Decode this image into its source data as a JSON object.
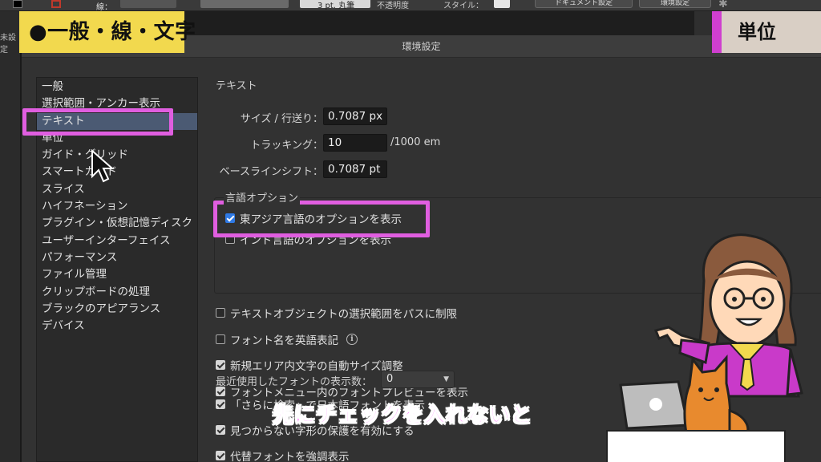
{
  "toolbar": {
    "stroke_label": "線：",
    "stroke_weight_value": "3 pt. 丸筆",
    "opacity_label": "不透明度",
    "style_label": "スタイル：",
    "document_settings_button": "ドキュメント設定",
    "preferences_button": "環境設定"
  },
  "background_panel": {
    "label": "未設定"
  },
  "dialog": {
    "title": "環境設定",
    "sidebar_items": [
      "一般",
      "選択範囲・アンカー表示",
      "テキスト",
      "単位",
      "ガイド・グリッド",
      "スマートガイド",
      "スライス",
      "ハイフネーション",
      "プラグイン・仮想記憶ディスク",
      "ユーザーインターフェイス",
      "パフォーマンス",
      "ファイル管理",
      "クリップボードの処理",
      "ブラックのアピアランス",
      "デバイス"
    ],
    "selected_sidebar_item": "テキスト",
    "text_section": {
      "title": "テキスト",
      "size_leading_label": "サイズ / 行送り：",
      "size_leading_value": "0.7087 px",
      "tracking_label": "トラッキング：",
      "tracking_value": "10",
      "tracking_unit": "/1000 em",
      "baseline_shift_label": "ベースラインシフト：",
      "baseline_shift_value": "0.7087 pt"
    },
    "language_options": {
      "title": "言語オプション",
      "east_asian_label": "東アジア言語のオプションを表示",
      "east_asian_checked": true,
      "indic_label": "インド言語のオプションを表示",
      "indic_checked": false
    },
    "options": [
      {
        "label": "テキストオブジェクトの選択範囲をパスに制限",
        "checked": false
      },
      {
        "label": "フォント名を英語表記",
        "checked": false,
        "info": "i"
      },
      {
        "label": "新規エリア内文字の自動サイズ調整",
        "checked": true
      },
      {
        "label": "フォントメニュー内のフォントプレビューを表示",
        "checked": true
      }
    ],
    "recent_fonts_label": "最近使用したフォントの表示数：",
    "recent_fonts_value": "0",
    "bottom_options": [
      {
        "label": "「さらに検索」で日本語フォントを表示",
        "checked": true
      },
      {
        "label": "見つからない字形の保護を有効にする",
        "checked": true
      },
      {
        "label": "代替フォントを強調表示",
        "checked": true
      }
    ]
  },
  "overlays": {
    "left_tag": "●一般・線・文字",
    "right_tag": "単位",
    "caption": "先にチェックを入れないと"
  },
  "colors": {
    "highlight": "#e05ee0",
    "left_tag_bg": "#f2d94e",
    "selected_item_bg": "#4b5a73",
    "checkbox_blue": "#2f7ae5"
  }
}
